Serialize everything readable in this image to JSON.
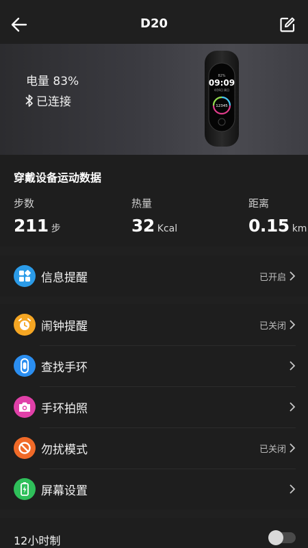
{
  "header": {
    "title": "D20"
  },
  "device": {
    "battery_text": "电量 83%",
    "connection_text": "已连接",
    "band_screen": {
      "top_text": "82%",
      "time": "09:09",
      "small_text": "4月6日 周日",
      "steps": "12345"
    }
  },
  "sport": {
    "title": "穿戴设备运动数据",
    "steps": {
      "label": "步数",
      "value": "211",
      "unit": "步"
    },
    "calories": {
      "label": "热量",
      "value": "32",
      "unit": "Kcal"
    },
    "distance": {
      "label": "距离",
      "value": "0.15",
      "unit": "km"
    }
  },
  "menu": {
    "notify": {
      "label": "信息提醒",
      "status": "已开启",
      "icon": "apps-icon",
      "color": "#2b9be8"
    },
    "alarm": {
      "label": "闹钟提醒",
      "status": "已关闭",
      "icon": "alarm-clock-icon",
      "color": "#f5a623"
    },
    "find": {
      "label": "查找手环",
      "status": "",
      "icon": "band-icon",
      "color": "#2b8ef0"
    },
    "camera": {
      "label": "手环拍照",
      "status": "",
      "icon": "camera-icon",
      "color": "#e040a8"
    },
    "dnd": {
      "label": "勿扰模式",
      "status": "已关闭",
      "icon": "no-disturb-icon",
      "color": "#f06a28"
    },
    "screen": {
      "label": "屏幕设置",
      "status": "",
      "icon": "screen-battery-icon",
      "color": "#2fbf5a"
    }
  },
  "settings": {
    "hour12_label": "12小时制",
    "hour12_enabled": false
  }
}
